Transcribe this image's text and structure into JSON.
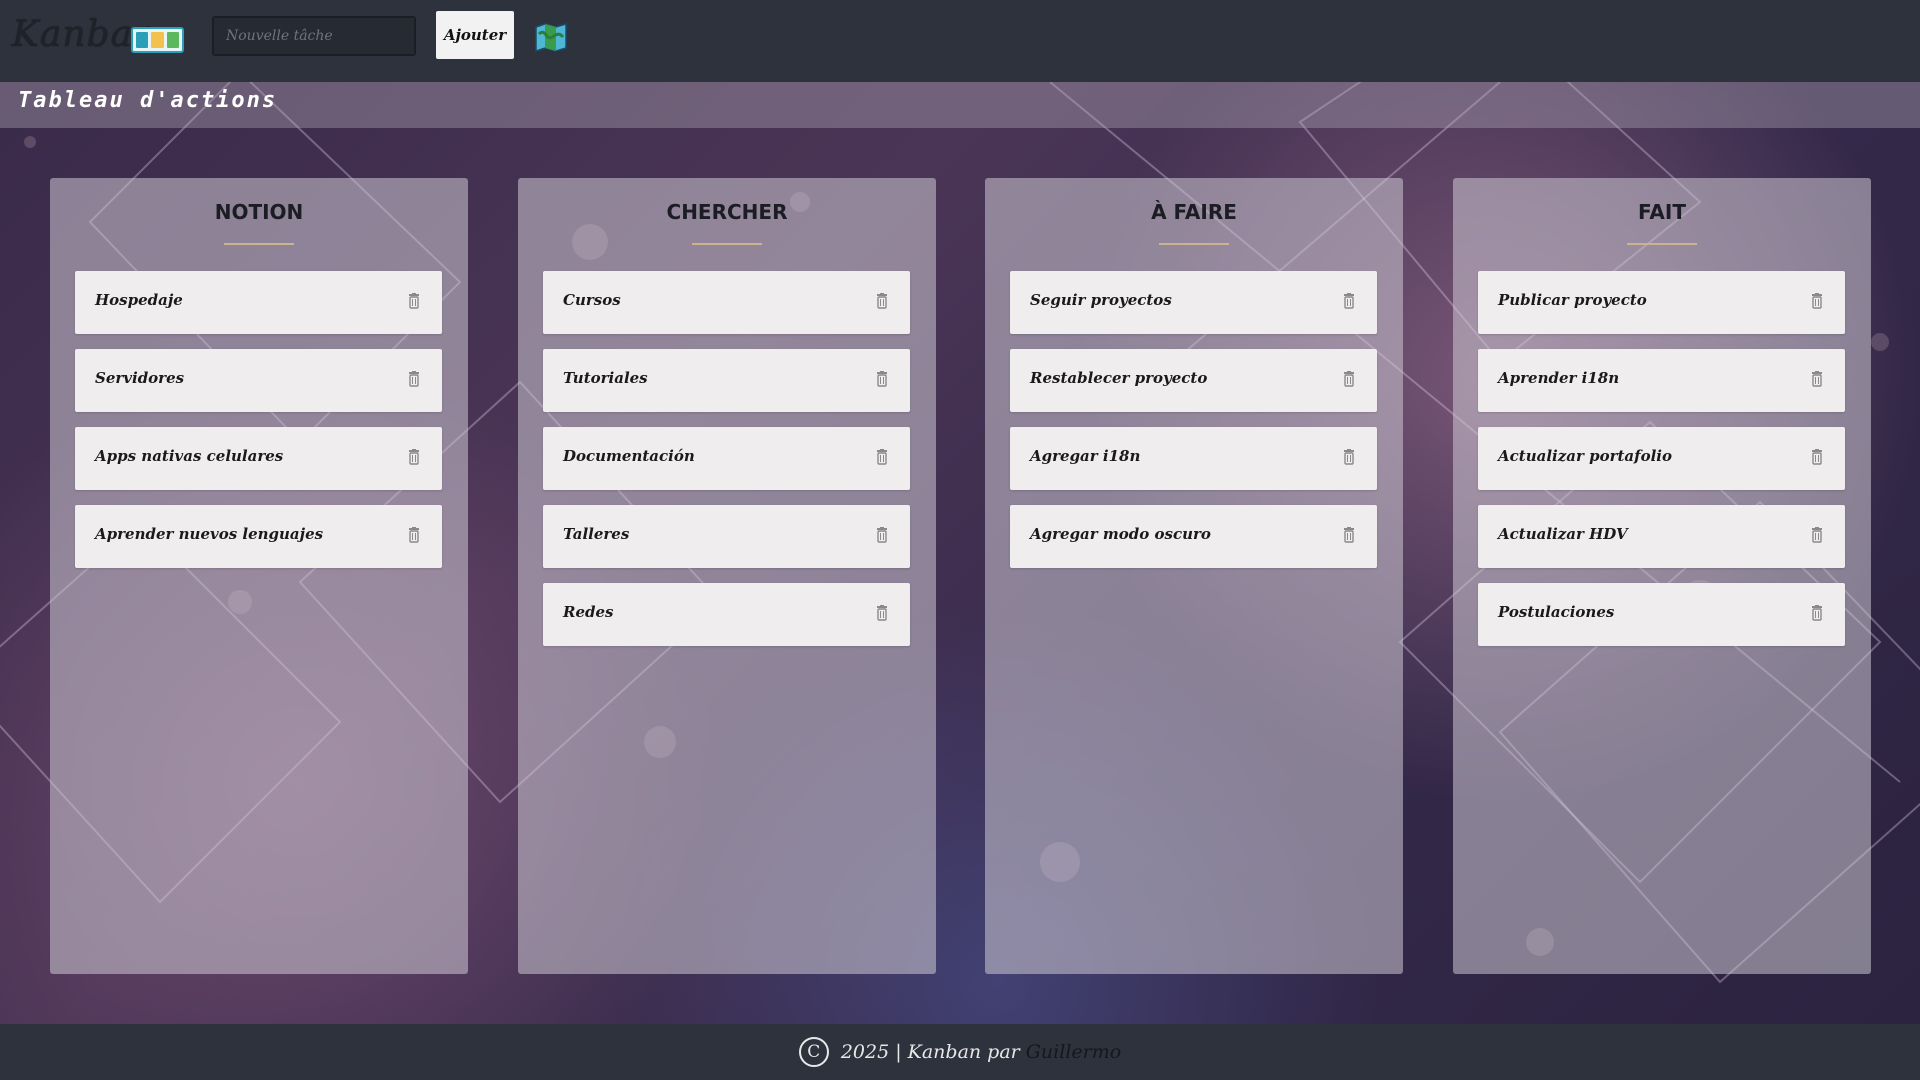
{
  "header": {
    "logo_text": "Kanban",
    "logo_icon": "kanban-board-icon",
    "new_task_placeholder": "Nouvelle tâche",
    "add_label": "Ajouter",
    "map_icon": "map-icon"
  },
  "board": {
    "title": "Tableau d'actions",
    "columns": [
      {
        "title": "NOTION",
        "cards": [
          "Hospedaje",
          "Servidores",
          "Apps nativas celulares",
          "Aprender nuevos lenguajes"
        ]
      },
      {
        "title": "CHERCHER",
        "cards": [
          "Cursos",
          "Tutoriales",
          "Documentación",
          "Talleres",
          "Redes"
        ]
      },
      {
        "title": "À FAIRE",
        "cards": [
          "Seguir proyectos",
          "Restablecer proyecto",
          "Agregar i18n",
          "Agregar modo oscuro"
        ]
      },
      {
        "title": "FAIT",
        "cards": [
          "Publicar proyecto",
          "Aprender i18n",
          "Actualizar portafolio",
          "Actualizar HDV",
          "Postulaciones"
        ]
      }
    ],
    "card_delete_icon": "trash-icon"
  },
  "footer": {
    "copyright_symbol": "C",
    "text": "2025 | Kanban par",
    "author": "Guillermo"
  },
  "colors": {
    "chrome": "#2e323d",
    "card": "#efeded",
    "accent_underline": "#c9b48f"
  }
}
